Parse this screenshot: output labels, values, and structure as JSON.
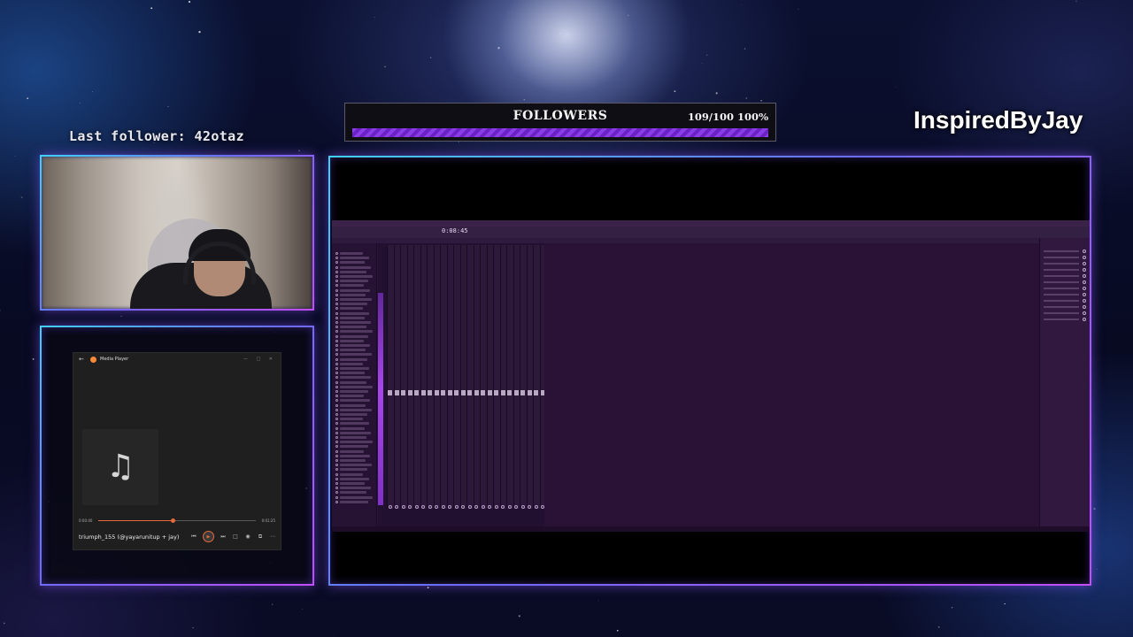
{
  "overlay": {
    "last_follower_label": "Last follower: 42otaz",
    "brand": "InspiredByJay"
  },
  "followers_goal": {
    "title": "FOLLOWERS",
    "count": "109/100 100%",
    "progress_percent": 100,
    "bar_color": "#8a3ce6"
  },
  "media_player": {
    "app_title": "Media Player",
    "elapsed": "0:00:40",
    "duration": "0:01:25",
    "progress_fraction": 0.47,
    "song_title": "triumph_155 (@yayarunitup + jay)",
    "accent_color": "#e86a3c",
    "icons": [
      "back-icon",
      "music-note-icon",
      "previous-icon",
      "play-icon",
      "next-icon",
      "repeat-icon",
      "view-icon",
      "miniplayer-icon",
      "more-icon"
    ]
  },
  "daw": {
    "clock": "0:08:45",
    "browser_item_count": 55,
    "mixer_track_count": 24
  },
  "colors": {
    "frame_gradient_start": "#3fd0ff",
    "frame_gradient_end": "#c24dff",
    "daw_background": "#2a1438"
  }
}
